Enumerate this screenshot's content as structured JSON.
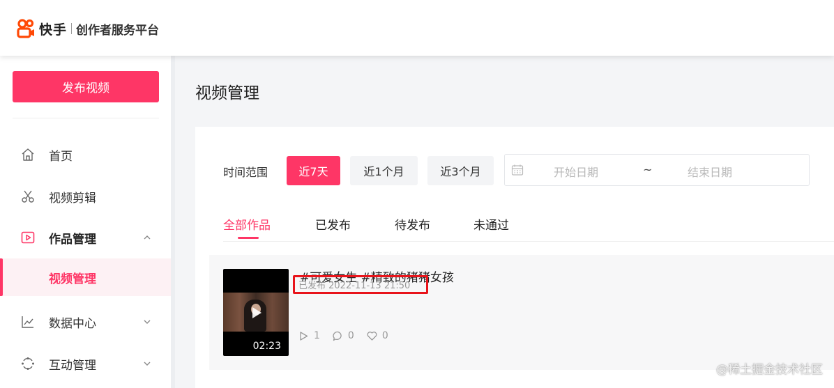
{
  "brand": {
    "name": "快手",
    "subtitle": "创作者服务平台",
    "accent_color": "#fe3666",
    "logo_icon": "kuaishou-logo-icon"
  },
  "sidebar": {
    "publish_label": "发布视频",
    "items": [
      {
        "label": "首页",
        "icon": "home-icon"
      },
      {
        "label": "视频剪辑",
        "icon": "scissors-icon"
      },
      {
        "label": "作品管理",
        "icon": "video-play-icon",
        "expanded": true
      },
      {
        "label": "视频管理",
        "active": true
      },
      {
        "label": "数据中心",
        "icon": "chart-icon",
        "expanded": false
      },
      {
        "label": "互动管理",
        "icon": "interaction-icon",
        "expanded": false
      }
    ]
  },
  "main": {
    "title": "视频管理",
    "filter": {
      "label": "时间范围",
      "ranges": [
        "近7天",
        "近1个月",
        "近3个月"
      ],
      "selected": "近7天",
      "start_placeholder": "开始日期",
      "separator": "~",
      "end_placeholder": "结束日期"
    },
    "tabs": [
      {
        "label": "全部作品",
        "active": true
      },
      {
        "label": "已发布"
      },
      {
        "label": "待发布"
      },
      {
        "label": "未通过"
      }
    ],
    "videos": [
      {
        "title": "#可爱女生  #精致的猪猪女孩",
        "status": "已发布 2022-11-13 21:50",
        "duration": "02:23",
        "plays": "1",
        "comments": "0",
        "likes": "0"
      }
    ]
  },
  "watermark": "@稀土掘金技术社区",
  "highlight_color": "#e8141b"
}
